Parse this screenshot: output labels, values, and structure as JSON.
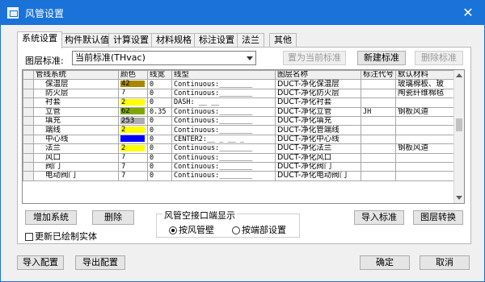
{
  "window": {
    "title": "风管设置",
    "close_glyph": "✕",
    "icon": "app-icon"
  },
  "tabs": [
    {
      "label": "系统设置",
      "active": true
    },
    {
      "label": "构件默认值",
      "active": false
    },
    {
      "label": "计算设置",
      "active": false
    },
    {
      "label": "材料规格",
      "active": false
    },
    {
      "label": "标注设置",
      "active": false
    },
    {
      "label": "法兰",
      "active": false
    },
    {
      "label": "其他",
      "active": false
    }
  ],
  "standard": {
    "label": "图层标准:",
    "selected": "当前标准(THvac)",
    "set_current_button": "置为当前标准",
    "new_button": "新建标准",
    "delete_button": "删除标准"
  },
  "grid": {
    "columns": [
      "管线系统",
      "颜色",
      "线宽",
      "线型",
      "图层名称",
      "标注代号",
      "默认材料"
    ],
    "rows": [
      {
        "name": "保温层",
        "color_index": "42",
        "color_hex": "#a88800",
        "width": "0",
        "linetype": "Continuous:________",
        "layer": "DUCT-净化保温层",
        "code": "",
        "material": "玻璃棉板、玻"
      },
      {
        "name": "防火层",
        "color_index": "7",
        "color_hex": "",
        "width": "0",
        "linetype": "Continuous:________",
        "layer": "DUCT-净化防火层",
        "code": "",
        "material": "陶瓷纤维棉毡"
      },
      {
        "name": "衬套",
        "color_index": "2",
        "color_hex": "#ffff00",
        "width": "0",
        "linetype": "DASH: __ __",
        "layer": "DUCT-净化衬套",
        "code": "",
        "material": ""
      },
      {
        "name": "立管",
        "color_index": "62",
        "color_hex": "#7ea800",
        "width": "0.35",
        "linetype": "Continuous:________",
        "layer": "DUCT-净化立管",
        "code": "JH",
        "material": "钢板风道"
      },
      {
        "name": "填充",
        "color_index": "253",
        "color_hex": "#adadad",
        "width": "0",
        "linetype": "Continuous:________",
        "layer": "DUCT-净化填充",
        "code": "",
        "material": ""
      },
      {
        "name": "端线",
        "color_index": "2",
        "color_hex": "#ffff00",
        "width": "0",
        "linetype": "Continuous:________",
        "layer": "DUCT-净化管端线",
        "code": "",
        "material": ""
      },
      {
        "name": "中心线",
        "color_index": "",
        "color_hex": "#0000ff",
        "width": "0",
        "linetype": "CENTER2:__ _ __ _",
        "layer": "DUCT-净化中心线",
        "code": "",
        "material": ""
      },
      {
        "name": "法兰",
        "color_index": "2",
        "color_hex": "#ffff00",
        "width": "0",
        "linetype": "Continuous:________",
        "layer": "DUCT-净化法兰",
        "code": "",
        "material": "钢板风道"
      },
      {
        "name": "风口",
        "color_index": "7",
        "color_hex": "",
        "width": "0",
        "linetype": "Continuous:________",
        "layer": "DUCT-净化风口",
        "code": "",
        "material": ""
      },
      {
        "name": "阀门",
        "color_index": "7",
        "color_hex": "",
        "width": "0",
        "linetype": "Continuous:________",
        "layer": "DUCT-净化阀门",
        "code": "",
        "material": ""
      },
      {
        "name": "电动阀门",
        "color_index": "7",
        "color_hex": "",
        "width": "0",
        "linetype": "Continuous:________",
        "layer": "DUCT-净化电动阀门",
        "code": "",
        "material": ""
      }
    ]
  },
  "actions": {
    "add_system": "增加系统",
    "delete": "删除",
    "import_standard": "导入标准",
    "layer_convert": "图层转换",
    "update_drawn": "更新已绘制实体",
    "port_group_label": "风管空接口端显示",
    "radio_wall": "按风管壁",
    "radio_end": "按端部设置",
    "import_config": "导入配置",
    "export_config": "导出配置",
    "ok": "确定",
    "cancel": "取消"
  },
  "colors": {
    "titlebar": "#1a73d9"
  }
}
